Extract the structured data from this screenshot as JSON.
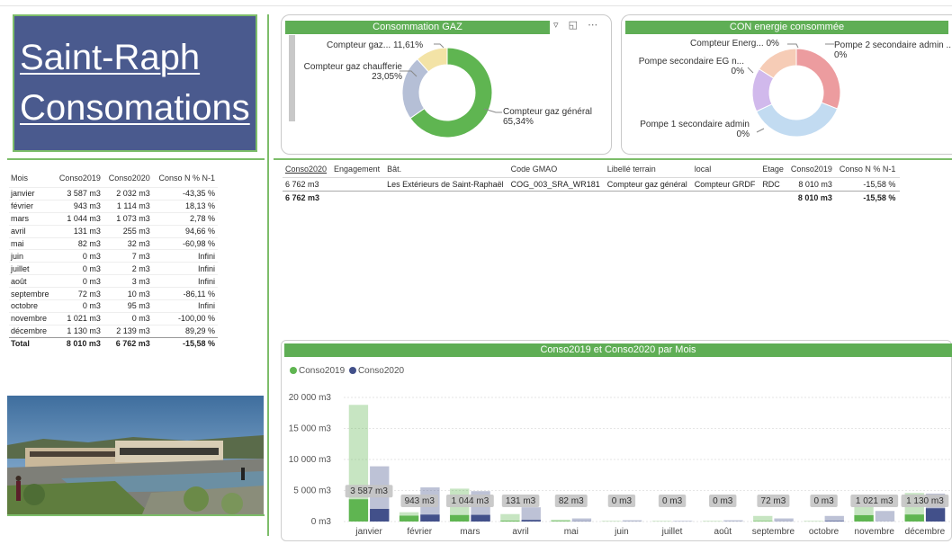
{
  "title": "Saint-Raph Consomations",
  "months_table": {
    "headers": [
      "Mois",
      "Conso2019",
      "Conso2020",
      "Conso N % N-1"
    ],
    "rows": [
      [
        "janvier",
        "3 587 m3",
        "2 032 m3",
        "-43,35 %"
      ],
      [
        "février",
        "943 m3",
        "1 114 m3",
        "18,13 %"
      ],
      [
        "mars",
        "1 044 m3",
        "1 073 m3",
        "2,78 %"
      ],
      [
        "avril",
        "131 m3",
        "255 m3",
        "94,66 %"
      ],
      [
        "mai",
        "82 m3",
        "32 m3",
        "-60,98 %"
      ],
      [
        "juin",
        "0 m3",
        "7 m3",
        "Infini"
      ],
      [
        "juillet",
        "0 m3",
        "2 m3",
        "Infini"
      ],
      [
        "août",
        "0 m3",
        "3 m3",
        "Infini"
      ],
      [
        "septembre",
        "72 m3",
        "10 m3",
        "-86,11 %"
      ],
      [
        "octobre",
        "0 m3",
        "95 m3",
        "Infini"
      ],
      [
        "novembre",
        "1 021 m3",
        "0 m3",
        "-100,00 %"
      ],
      [
        "décembre",
        "1 130 m3",
        "2 139 m3",
        "89,29 %"
      ]
    ],
    "total": [
      "Total",
      "8 010 m3",
      "6 762 m3",
      "-15,58 %"
    ]
  },
  "gaz_panel": {
    "title": "Consommation GAZ",
    "icons": [
      "filter-icon",
      "focus-mode-icon",
      "more-options-icon"
    ],
    "slices": [
      {
        "label": "Compteur gaz général",
        "value_label": "65,34%",
        "value": 65.34,
        "color": "#5fb551"
      },
      {
        "label": "Compteur gaz chaufferie",
        "value_label": "23,05%",
        "value": 23.05,
        "color": "#b5bfd6"
      },
      {
        "label": "Compteur gaz...",
        "value_label": "11,61%",
        "value": 11.61,
        "color": "#f3e3a6"
      }
    ]
  },
  "energie_panel": {
    "title": "CON energie consommée",
    "slices": [
      {
        "label": "Pompe 2 secondaire admin ...",
        "value_label": "0%",
        "value": 31,
        "color": "#ec9c9f"
      },
      {
        "label": "Pompe 1 secondaire admin",
        "value_label": "0%",
        "value": 37,
        "color": "#c2dbf1"
      },
      {
        "label": "Pompe secondaire EG n...",
        "value_label": "0%",
        "value": 16,
        "color": "#d1b9ec"
      },
      {
        "label": "Compteur Energ...",
        "value_label": "0%",
        "value": 16,
        "color": "#f6ccb6"
      }
    ]
  },
  "details_table": {
    "headers": [
      "Conso2020",
      "Engagement",
      "Bât.",
      "Code GMAO",
      "Libellé terrain",
      "local",
      "Etage",
      "Conso2019",
      "Conso N % N-1"
    ],
    "row": [
      "6 762 m3",
      "",
      "Les Extérieurs de Saint-Raphaël",
      "COG_003_SRA_WR181",
      "Compteur gaz général",
      "Compteur GRDF",
      "RDC",
      "8 010 m3",
      "-15,58 %"
    ],
    "total": [
      "6 762 m3",
      "",
      "",
      "",
      "",
      "",
      "",
      "8 010 m3",
      "-15,58 %"
    ]
  },
  "chart_data": {
    "type": "bar",
    "title": "Conso2019 et Conso2020 par Mois",
    "categories": [
      "janvier",
      "février",
      "mars",
      "avril",
      "mai",
      "juin",
      "juillet",
      "août",
      "septembre",
      "octobre",
      "novembre",
      "décembre"
    ],
    "series": [
      {
        "name": "Conso2019",
        "color": "#5fb551",
        "values": [
          3587,
          943,
          1044,
          131,
          82,
          0,
          0,
          0,
          72,
          0,
          1021,
          1130
        ],
        "labels": [
          "3 587 m3",
          "943 m3",
          "1 044 m3",
          "131 m3",
          "82 m3",
          "0 m3",
          "0 m3",
          "0 m3",
          "72 m3",
          "0 m3",
          "1 021 m3",
          "1 130 m3"
        ]
      },
      {
        "name": "Conso2020",
        "color": "#42508a",
        "values": [
          2032,
          1114,
          1073,
          255,
          32,
          7,
          2,
          3,
          10,
          95,
          0,
          2139
        ]
      }
    ],
    "background_values_2019": [
      18800,
      1500,
      5300,
      1200,
      300,
      100,
      100,
      100,
      900,
      100,
      2400,
      4600
    ],
    "background_values_2020": [
      8900,
      5500,
      4900,
      2300,
      500,
      200,
      100,
      200,
      500,
      900,
      1700,
      4500
    ],
    "yticks": [
      "0 m3",
      "5 000 m3",
      "10 000 m3",
      "15 000 m3",
      "20 000 m3"
    ],
    "ytick_values": [
      0,
      5000,
      10000,
      15000,
      20000
    ],
    "ylim": [
      0,
      20000
    ],
    "grid": true,
    "legend": "top-left"
  }
}
